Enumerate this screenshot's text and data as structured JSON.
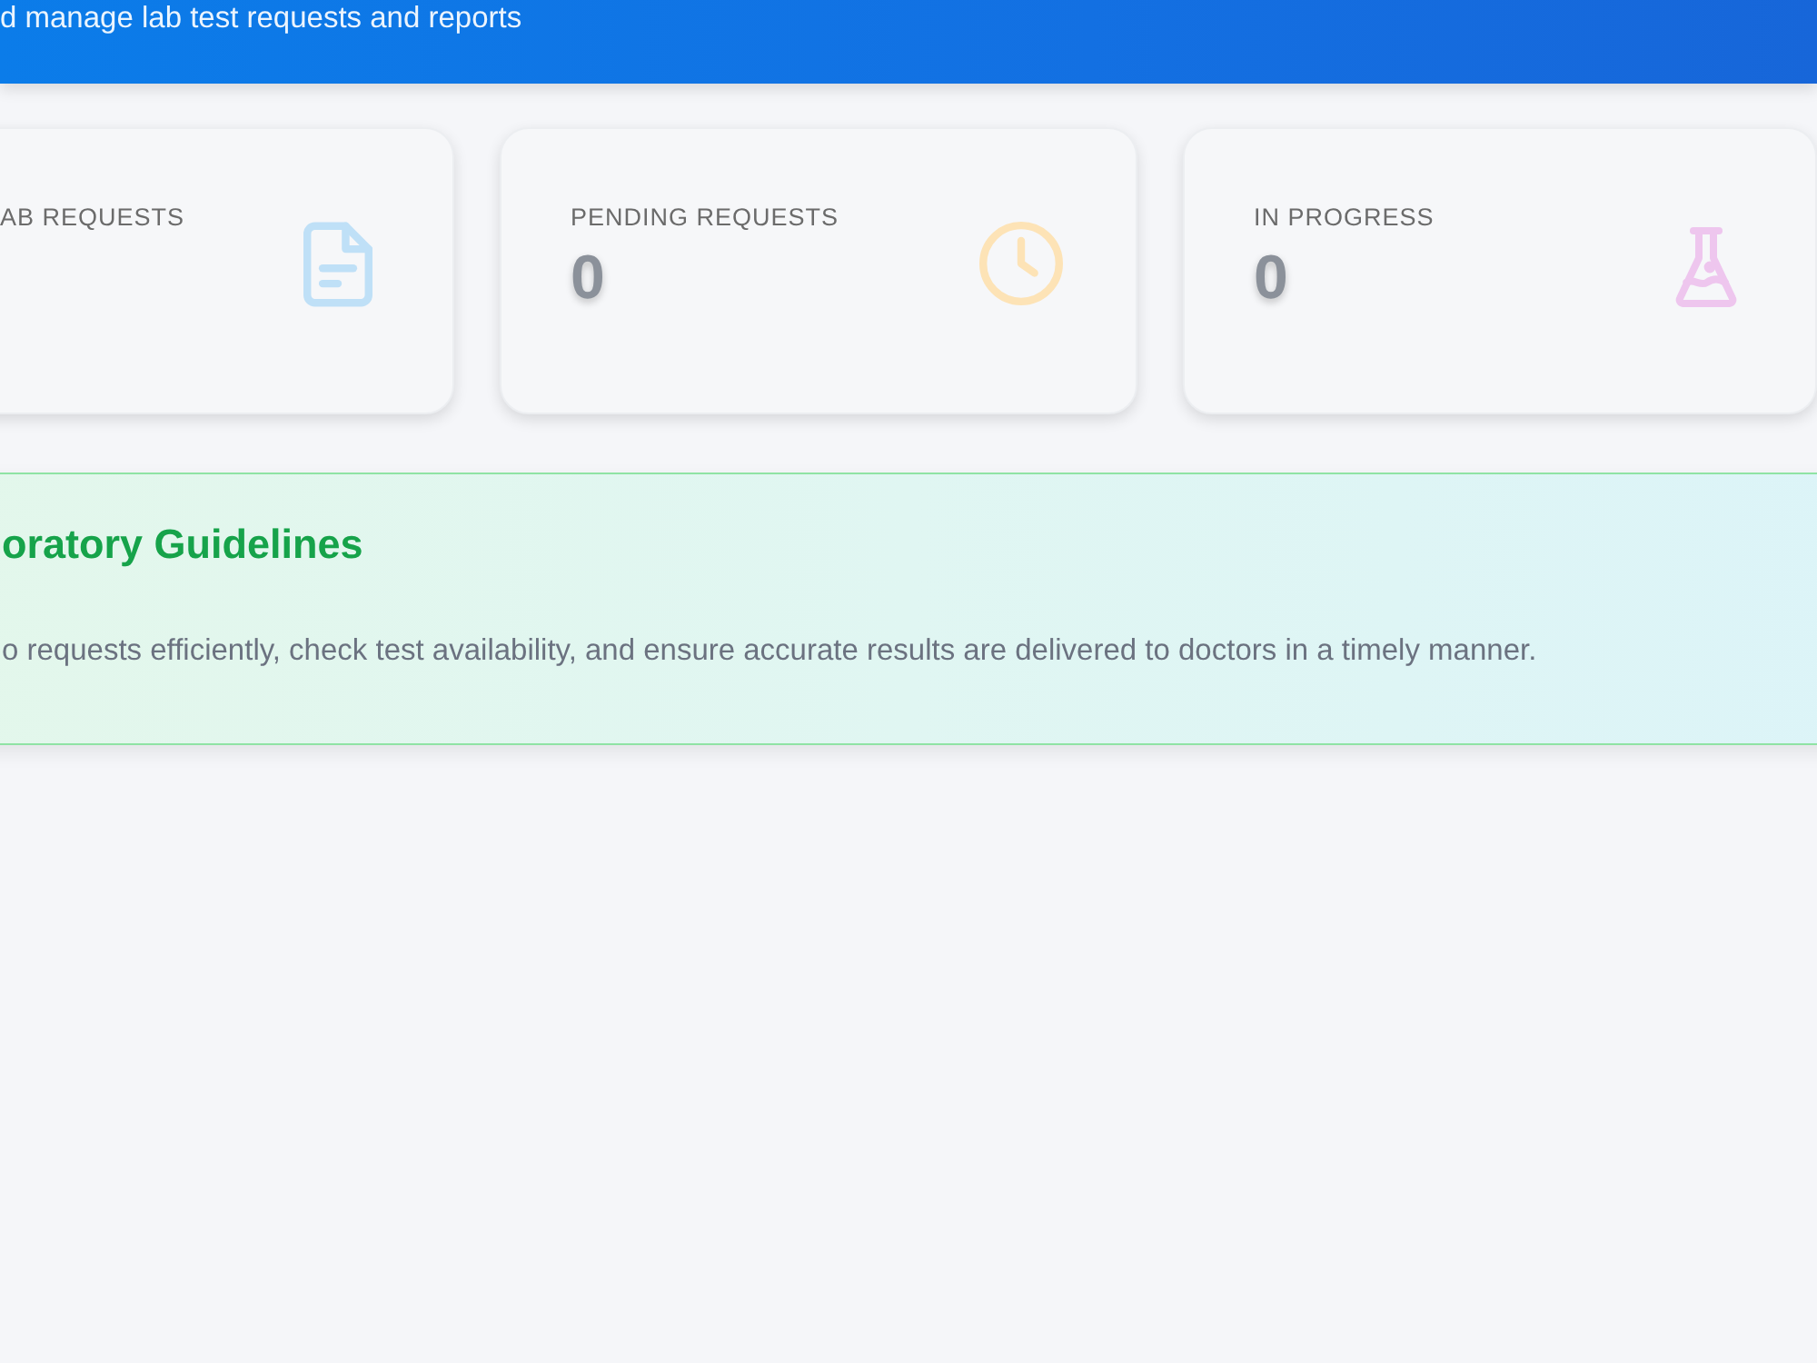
{
  "header": {
    "subtitle": "d manage lab test requests and reports"
  },
  "stats": [
    {
      "label": "AB REQUESTS",
      "kind": "document",
      "color": "#bfe0f7"
    },
    {
      "label": "PENDING REQUESTS",
      "value": "0",
      "kind": "clock",
      "color": "#fde3b6"
    },
    {
      "label": "IN PROGRESS",
      "value": "0",
      "kind": "flask",
      "color": "#eec6ee"
    }
  ],
  "guidelines": {
    "title": "oratory Guidelines",
    "text": "o requests efficiently, check test availability, and ensure accurate results are delivered to doctors in a timely manner."
  }
}
